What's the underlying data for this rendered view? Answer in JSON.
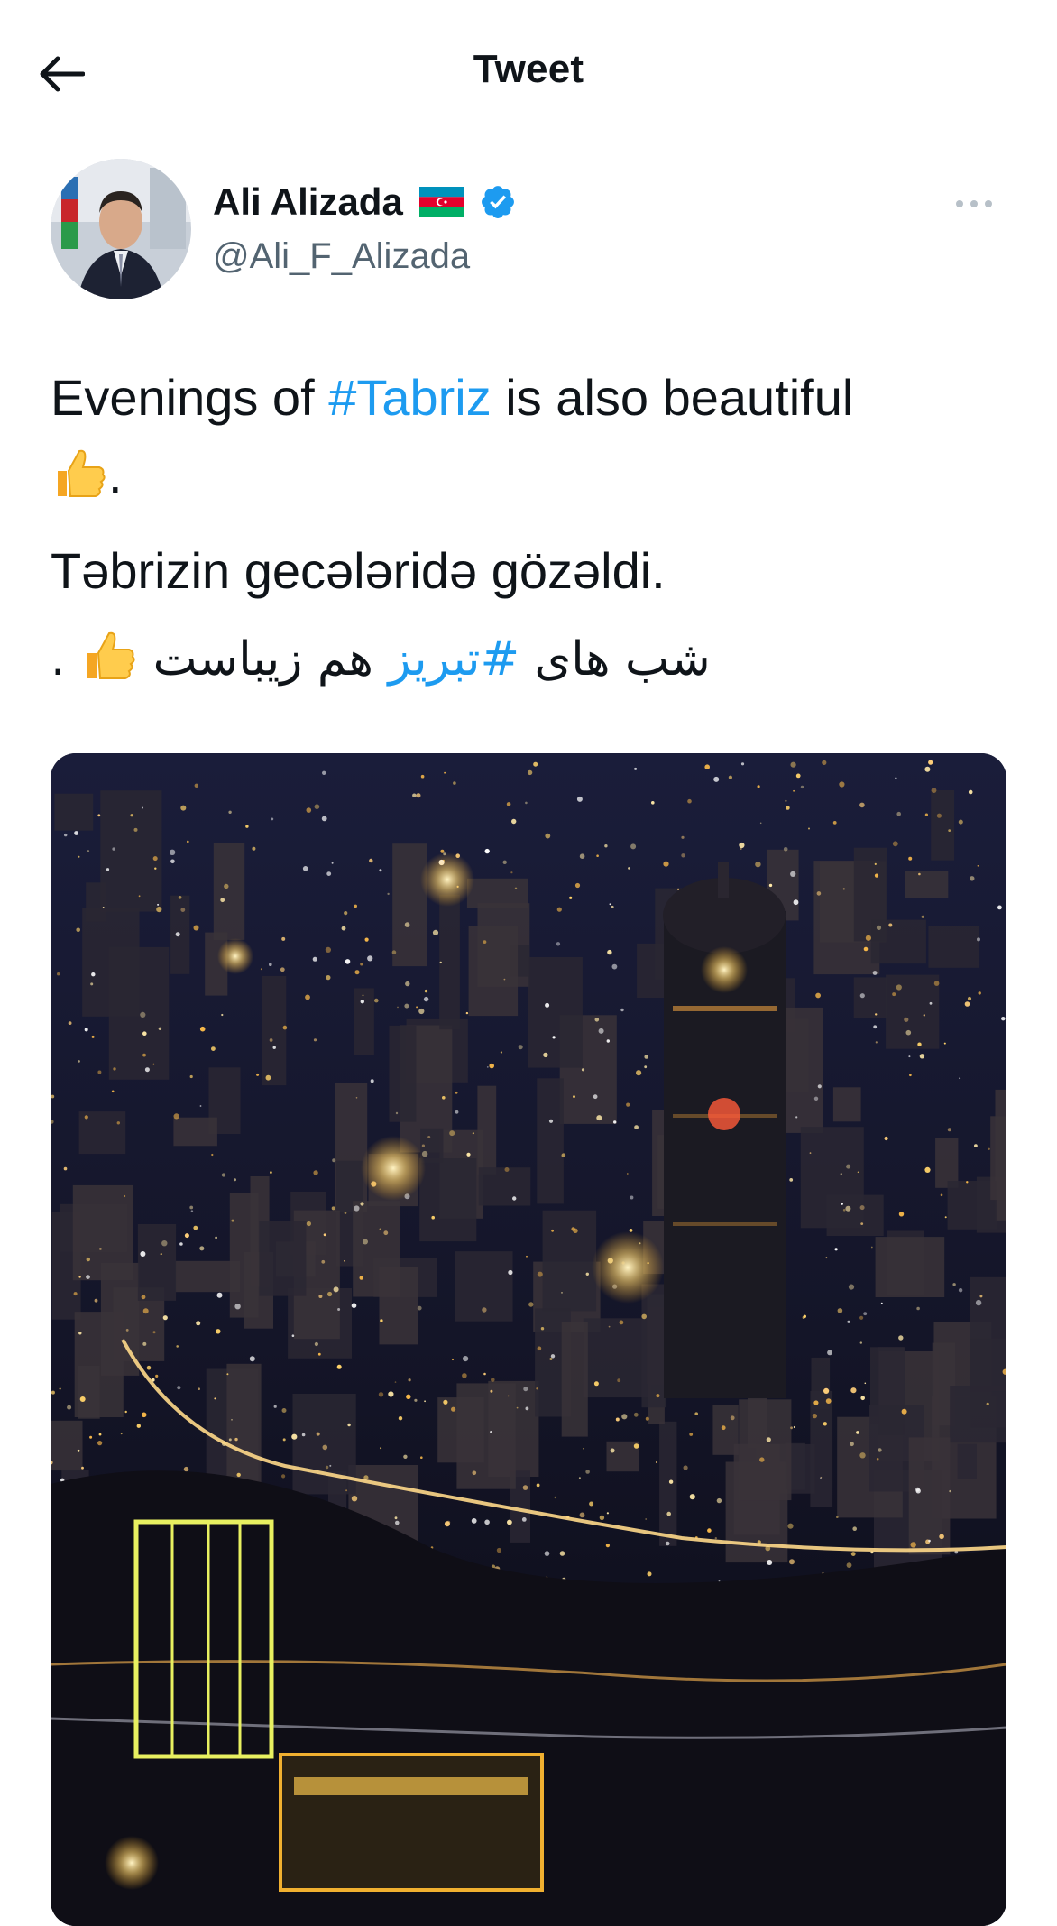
{
  "header": {
    "back_icon": "arrow-left-icon",
    "title": "Tweet"
  },
  "author": {
    "display_name": "Ali Alizada",
    "flag_icon": "azerbaijan-flag-icon",
    "verified_icon": "verified-badge-icon",
    "handle": "@Ali_F_Alizada",
    "more_icon": "more-horizontal-icon"
  },
  "tweet": {
    "line1_before": "Evenings of ",
    "line1_hashtag": "#Tabriz",
    "line1_after": " is also beautiful",
    "line1_tail": ".",
    "emoji_icon": "thumbs-up-emoji",
    "line2": "Təbrizin gecələridə gözəldi.",
    "line3_before": "شب های ",
    "line3_hashtag": "#تبریز",
    "line3_after": " هم زیباست",
    "line3_tail": " ."
  },
  "media": {
    "image_icon": "tabriz-night-skyline-photo"
  },
  "colors": {
    "accent": "#1d9bf0",
    "secondary_text": "#536471",
    "primary_text": "#0f1419"
  }
}
